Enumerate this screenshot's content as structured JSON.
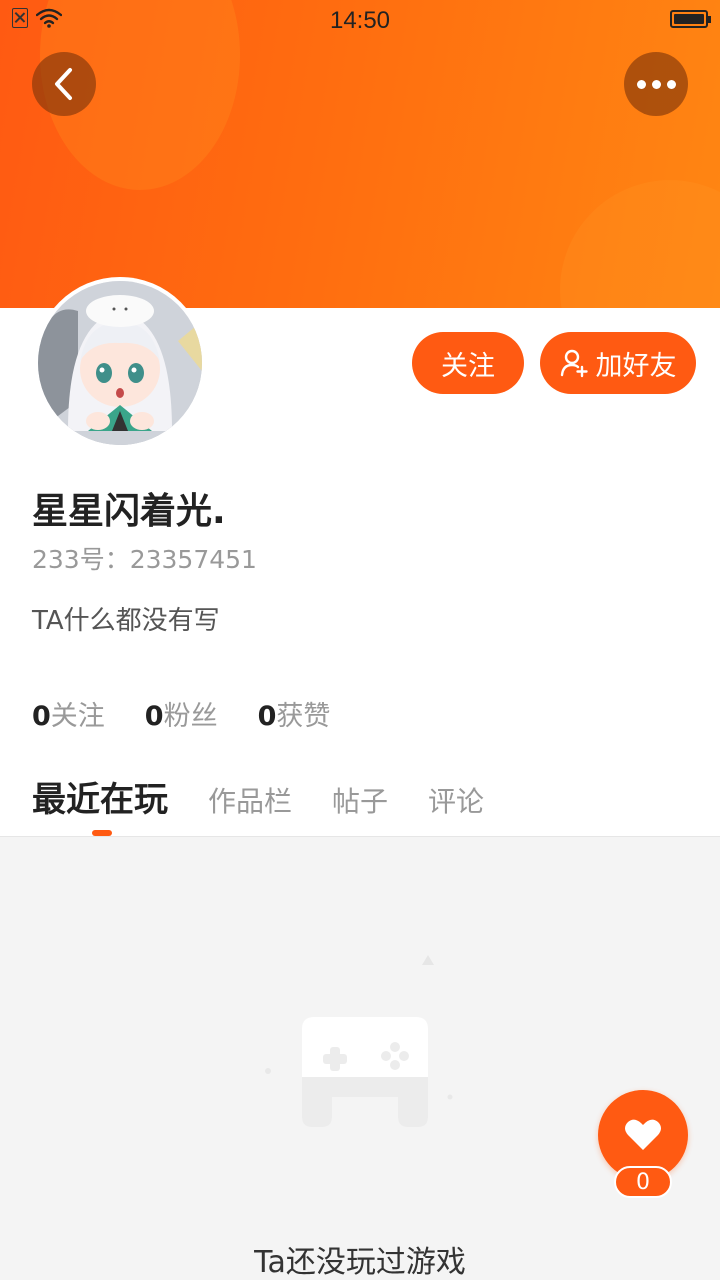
{
  "status_bar": {
    "time": "14:50"
  },
  "profile": {
    "nickname": "星星闪着光.",
    "uid_label": "233号：",
    "uid_value": "23357451",
    "bio": "TA什么都没有写"
  },
  "actions": {
    "follow_label": "关注",
    "add_friend_label": "加好友"
  },
  "stats": [
    {
      "value": "0",
      "label": "关注"
    },
    {
      "value": "0",
      "label": "粉丝"
    },
    {
      "value": "0",
      "label": "获赞"
    }
  ],
  "tabs": [
    {
      "label": "最近在玩",
      "active": true
    },
    {
      "label": "作品栏",
      "active": false
    },
    {
      "label": "帖子",
      "active": false
    },
    {
      "label": "评论",
      "active": false
    }
  ],
  "empty_state": {
    "text": "Ta还没玩过游戏"
  },
  "like": {
    "count": "0"
  },
  "icons": {
    "back": "back-arrow-icon",
    "more": "more-dots-icon",
    "add_friend": "add-user-icon",
    "like": "heart-icon",
    "empty": "gamepad-icon"
  },
  "colors": {
    "accent": "#ff5a12",
    "header_start": "#ff5a12",
    "header_end": "#ff8612"
  }
}
